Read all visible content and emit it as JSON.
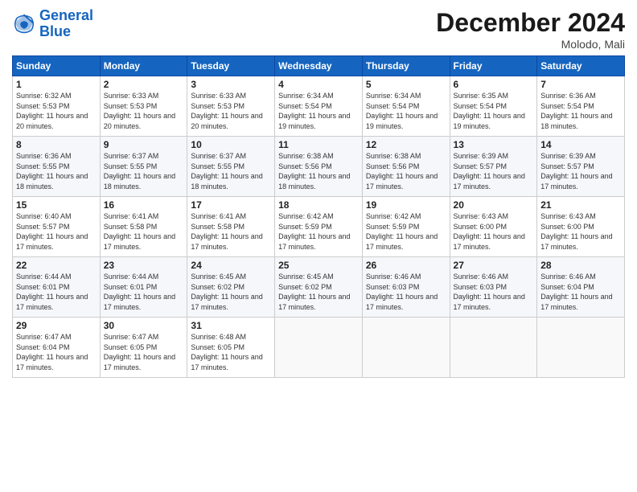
{
  "logo": {
    "line1": "General",
    "line2": "Blue"
  },
  "title": "December 2024",
  "subtitle": "Molodo, Mali",
  "weekdays": [
    "Sunday",
    "Monday",
    "Tuesday",
    "Wednesday",
    "Thursday",
    "Friday",
    "Saturday"
  ],
  "weeks": [
    [
      {
        "day": "1",
        "sunrise": "6:32 AM",
        "sunset": "5:53 PM",
        "daylight": "11 hours and 20 minutes."
      },
      {
        "day": "2",
        "sunrise": "6:33 AM",
        "sunset": "5:53 PM",
        "daylight": "11 hours and 20 minutes."
      },
      {
        "day": "3",
        "sunrise": "6:33 AM",
        "sunset": "5:53 PM",
        "daylight": "11 hours and 20 minutes."
      },
      {
        "day": "4",
        "sunrise": "6:34 AM",
        "sunset": "5:54 PM",
        "daylight": "11 hours and 19 minutes."
      },
      {
        "day": "5",
        "sunrise": "6:34 AM",
        "sunset": "5:54 PM",
        "daylight": "11 hours and 19 minutes."
      },
      {
        "day": "6",
        "sunrise": "6:35 AM",
        "sunset": "5:54 PM",
        "daylight": "11 hours and 19 minutes."
      },
      {
        "day": "7",
        "sunrise": "6:36 AM",
        "sunset": "5:54 PM",
        "daylight": "11 hours and 18 minutes."
      }
    ],
    [
      {
        "day": "8",
        "sunrise": "6:36 AM",
        "sunset": "5:55 PM",
        "daylight": "11 hours and 18 minutes."
      },
      {
        "day": "9",
        "sunrise": "6:37 AM",
        "sunset": "5:55 PM",
        "daylight": "11 hours and 18 minutes."
      },
      {
        "day": "10",
        "sunrise": "6:37 AM",
        "sunset": "5:55 PM",
        "daylight": "11 hours and 18 minutes."
      },
      {
        "day": "11",
        "sunrise": "6:38 AM",
        "sunset": "5:56 PM",
        "daylight": "11 hours and 18 minutes."
      },
      {
        "day": "12",
        "sunrise": "6:38 AM",
        "sunset": "5:56 PM",
        "daylight": "11 hours and 17 minutes."
      },
      {
        "day": "13",
        "sunrise": "6:39 AM",
        "sunset": "5:57 PM",
        "daylight": "11 hours and 17 minutes."
      },
      {
        "day": "14",
        "sunrise": "6:39 AM",
        "sunset": "5:57 PM",
        "daylight": "11 hours and 17 minutes."
      }
    ],
    [
      {
        "day": "15",
        "sunrise": "6:40 AM",
        "sunset": "5:57 PM",
        "daylight": "11 hours and 17 minutes."
      },
      {
        "day": "16",
        "sunrise": "6:41 AM",
        "sunset": "5:58 PM",
        "daylight": "11 hours and 17 minutes."
      },
      {
        "day": "17",
        "sunrise": "6:41 AM",
        "sunset": "5:58 PM",
        "daylight": "11 hours and 17 minutes."
      },
      {
        "day": "18",
        "sunrise": "6:42 AM",
        "sunset": "5:59 PM",
        "daylight": "11 hours and 17 minutes."
      },
      {
        "day": "19",
        "sunrise": "6:42 AM",
        "sunset": "5:59 PM",
        "daylight": "11 hours and 17 minutes."
      },
      {
        "day": "20",
        "sunrise": "6:43 AM",
        "sunset": "6:00 PM",
        "daylight": "11 hours and 17 minutes."
      },
      {
        "day": "21",
        "sunrise": "6:43 AM",
        "sunset": "6:00 PM",
        "daylight": "11 hours and 17 minutes."
      }
    ],
    [
      {
        "day": "22",
        "sunrise": "6:44 AM",
        "sunset": "6:01 PM",
        "daylight": "11 hours and 17 minutes."
      },
      {
        "day": "23",
        "sunrise": "6:44 AM",
        "sunset": "6:01 PM",
        "daylight": "11 hours and 17 minutes."
      },
      {
        "day": "24",
        "sunrise": "6:45 AM",
        "sunset": "6:02 PM",
        "daylight": "11 hours and 17 minutes."
      },
      {
        "day": "25",
        "sunrise": "6:45 AM",
        "sunset": "6:02 PM",
        "daylight": "11 hours and 17 minutes."
      },
      {
        "day": "26",
        "sunrise": "6:46 AM",
        "sunset": "6:03 PM",
        "daylight": "11 hours and 17 minutes."
      },
      {
        "day": "27",
        "sunrise": "6:46 AM",
        "sunset": "6:03 PM",
        "daylight": "11 hours and 17 minutes."
      },
      {
        "day": "28",
        "sunrise": "6:46 AM",
        "sunset": "6:04 PM",
        "daylight": "11 hours and 17 minutes."
      }
    ],
    [
      {
        "day": "29",
        "sunrise": "6:47 AM",
        "sunset": "6:04 PM",
        "daylight": "11 hours and 17 minutes."
      },
      {
        "day": "30",
        "sunrise": "6:47 AM",
        "sunset": "6:05 PM",
        "daylight": "11 hours and 17 minutes."
      },
      {
        "day": "31",
        "sunrise": "6:48 AM",
        "sunset": "6:05 PM",
        "daylight": "11 hours and 17 minutes."
      },
      null,
      null,
      null,
      null
    ]
  ]
}
